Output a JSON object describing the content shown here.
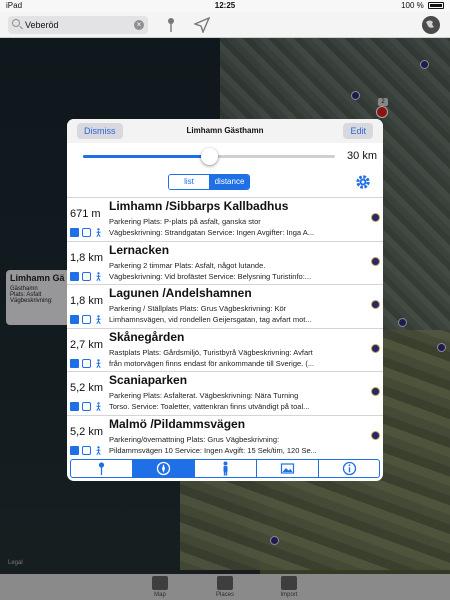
{
  "status": {
    "carrier": "iPad",
    "time": "12:25",
    "battery": "100 %"
  },
  "search": {
    "value": "Veberöd"
  },
  "map": {
    "callout": {
      "title": "Limhamn Gä",
      "lines": [
        "Gästhamn",
        "Plats: Asfalt",
        "Vägbeskrivning:"
      ]
    },
    "cluster_count": "2",
    "legal": "Legal"
  },
  "tabs": [
    {
      "label": "Map"
    },
    {
      "label": "Places"
    },
    {
      "label": "Import"
    }
  ],
  "modal": {
    "dismiss_label": "Dismiss",
    "title": "Limhamn Gästhamn",
    "edit_label": "Edit",
    "slider": {
      "fraction": 0.5,
      "value_label": "30 km"
    },
    "segments": [
      {
        "label": "list"
      },
      {
        "label": "distance"
      }
    ],
    "selected_segment": "distance",
    "rows": [
      {
        "distance": "671 m",
        "name": "Limhamn /Sibbarps Kallbadhus",
        "line1": "Parkering Plats: P-plats på asfalt, ganska stor",
        "line2": "Vägbeskrivning: Strandgatan Service: Ingen Avgifter: Inga A..."
      },
      {
        "distance": "1,8 km",
        "name": "Lernacken",
        "line1": "Parkering 2 timmar Plats: Asfalt, något lutande.",
        "line2": "Vägbeskrivning: Vid brofästet Service: Belysning Turistinfo:..."
      },
      {
        "distance": "1,8 km",
        "name": "Lagunen /Andelshamnen",
        "line1": "Parkering / Ställplats Plats: Grus Vägbeskrivning: Kör",
        "line2": "Limhamnsvägen, vid rondellen Geijersgatan, tag avfart mot..."
      },
      {
        "distance": "2,7 km",
        "name": "Skånegården",
        "line1": "Rastplats Plats: Gårdsmiljö, Turistbyrå Vägbeskrivning: Avfart",
        "line2": "från motorvägen finns endast för ankommande till Sverige. (..."
      },
      {
        "distance": "5,2 km",
        "name": "Scaniaparken",
        "line1": "Parkering Plats: Asfalterat. Vägbeskrivning: Nära Turning",
        "line2": "Torso. Service: Toaletter, vattenkran finns utvändigt på toal..."
      },
      {
        "distance": "5,2 km",
        "name": "Malmö /Pildammsvägen",
        "line1": "Parkering/övernattning Plats: Grus Vägbeskrivning:",
        "line2": "Pildammsvägen 10 Service: Ingen Avgift: 15 Sek/tim, 120 Se..."
      }
    ],
    "toolbar": [
      "pin-icon",
      "compass-icon",
      "person-icon",
      "photo-icon",
      "info-icon"
    ],
    "active_tool": "compass-icon"
  },
  "colors": {
    "accent": "#1f6fe6",
    "pin": "#d41f1f"
  }
}
